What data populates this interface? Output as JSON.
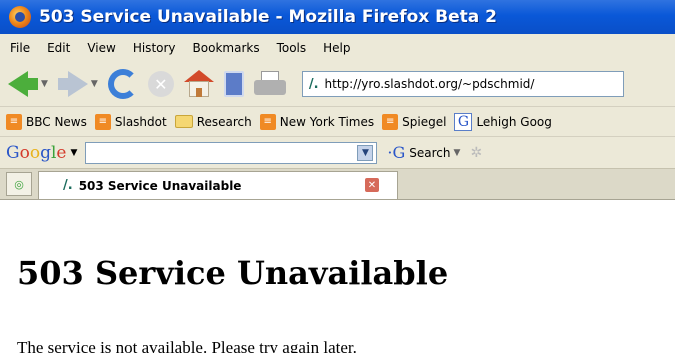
{
  "window": {
    "title": "503 Service Unavailable - Mozilla Firefox Beta 2"
  },
  "menu": [
    "File",
    "Edit",
    "View",
    "History",
    "Bookmarks",
    "Tools",
    "Help"
  ],
  "navigation": {
    "url": "http://yro.slashdot.org/~pdschmid/"
  },
  "bookmarks": [
    {
      "label": "BBC News",
      "icon": "rss-icon"
    },
    {
      "label": "Slashdot",
      "icon": "rss-icon"
    },
    {
      "label": "Research",
      "icon": "folder-icon"
    },
    {
      "label": "New York Times",
      "icon": "rss-icon"
    },
    {
      "label": "Spiegel",
      "icon": "rss-icon"
    },
    {
      "label": "Lehigh Goog",
      "icon": "google-icon"
    }
  ],
  "google_toolbar": {
    "logo": "Google",
    "search_label": "Search"
  },
  "tabs": [
    {
      "label": "503 Service Unavailable"
    }
  ],
  "page": {
    "heading": "503 Service Unavailable",
    "message": "The service is not available. Please try again later."
  }
}
